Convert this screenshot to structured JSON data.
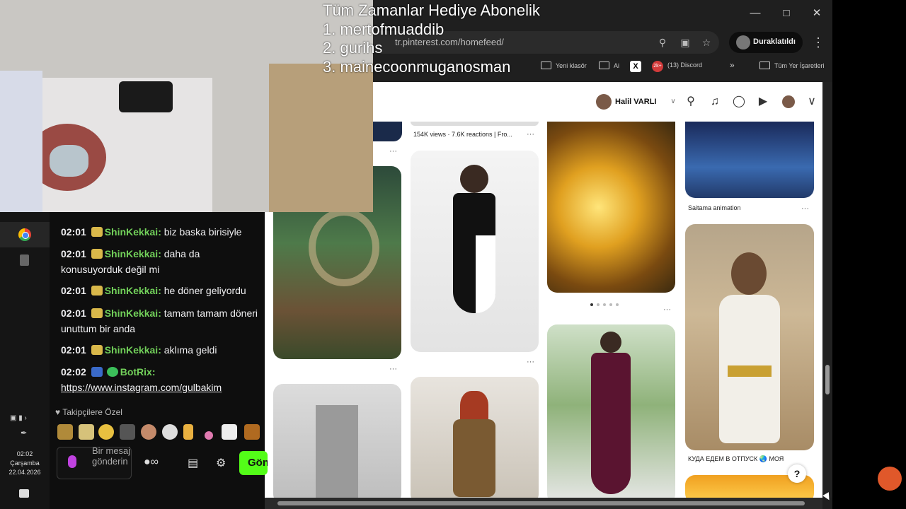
{
  "overlay": {
    "title": "Tüm Zamanlar Hediye  Abonelik",
    "lines": [
      "1. mertofmuaddib",
      "2. gurihs",
      "3. mainecoonmuganosman"
    ]
  },
  "browser": {
    "url": "tr.pinterest.com/homefeed/",
    "profile_status": "Duraklatıldı",
    "window_controls": [
      "minimize-icon",
      "maximize-icon",
      "close-icon"
    ],
    "bookmarks": [
      {
        "label": "Yeni klasör",
        "icon": "folder-icon"
      },
      {
        "label": "Ai",
        "icon": "folder-icon"
      },
      {
        "label": "",
        "icon": "x-logo-icon"
      },
      {
        "label": "(13) Discord",
        "icon": "discord-icon",
        "badge": "2k+"
      }
    ],
    "all_bookmarks": "Tüm Yer İşaretleri",
    "more_bookmarks": "»"
  },
  "pinterest": {
    "profile_name": "Halil VARLI",
    "pin_captions": [
      "154K views · 7.6K reactions | Fro...",
      "Saitama animation",
      "КУДА ЕДЕМ В ОТПУСК 🌏 МОЯ"
    ],
    "more_dots": "···",
    "help": "?"
  },
  "chat": {
    "messages": [
      {
        "time": "02:01",
        "user": "ShinKekkai",
        "text": "biz baska birisiyle"
      },
      {
        "time": "02:01",
        "user": "ShinKekkai",
        "text": "daha da konusuyorduk değil mi"
      },
      {
        "time": "02:01",
        "user": "ShinKekkai",
        "text": "he döner geliyordu"
      },
      {
        "time": "02:01",
        "user": "ShinKekkai",
        "text": "tamam tamam döneri unuttum bir anda"
      },
      {
        "time": "02:01",
        "user": "ShinKekkai",
        "text": "aklıma geldi"
      },
      {
        "time": "02:02",
        "user": "BotRix",
        "text": "https://www.instagram.com/gulbakim"
      }
    ],
    "followers_only": "Takipçilere Özel",
    "input_placeholder": "Bir mesaj gönderin",
    "send_label": "Gönder"
  },
  "taskbar": {
    "time": "02:02",
    "day": "Çarşamba",
    "date": "22.04.2026"
  },
  "colors": {
    "username": "#72d05a",
    "send_button": "#53fc18",
    "chat_bg": "#0e0e0e",
    "browser_bg": "#1f1f1f"
  }
}
